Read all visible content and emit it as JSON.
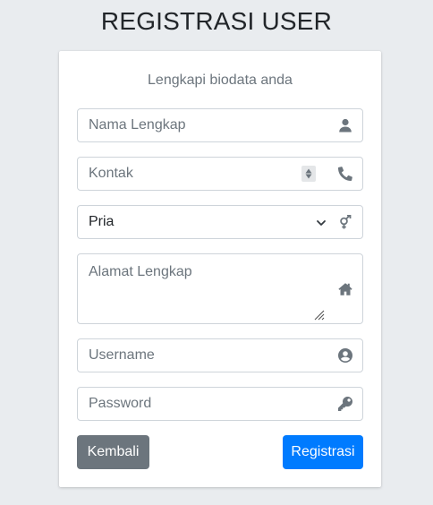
{
  "page": {
    "title": "REGISTRASI USER"
  },
  "form": {
    "subtitle": "Lengkapi biodata anda",
    "fields": {
      "nama": {
        "placeholder": "Nama Lengkap",
        "icon": "user-icon"
      },
      "kontak": {
        "placeholder": "Kontak",
        "icon": "phone-icon"
      },
      "gender": {
        "value": "Pria",
        "icon": "venus-mars-icon"
      },
      "alamat": {
        "placeholder": "Alamat Lengkap",
        "icon": "home-icon"
      },
      "username": {
        "placeholder": "Username",
        "icon": "user-circle-icon"
      },
      "password": {
        "placeholder": "Password",
        "icon": "key-icon"
      }
    },
    "buttons": {
      "back": "Kembali",
      "register": "Registrasi"
    }
  },
  "colors": {
    "background": "#e9ecef",
    "primary": "#007bff",
    "secondary": "#6c757d",
    "border": "#ced4da"
  }
}
